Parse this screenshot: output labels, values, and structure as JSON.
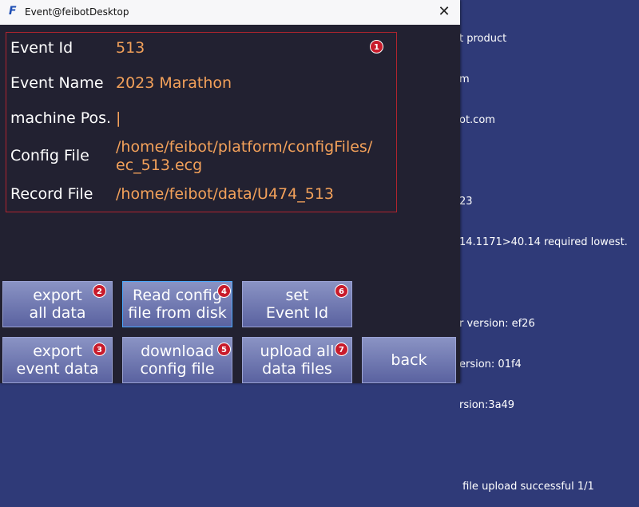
{
  "background": {
    "lines": [
      "t product",
      "m",
      "ot.com",
      "",
      "23",
      "14.1171>40.14 required lowest.",
      "",
      "r version: ef26",
      "ersion: 01f4",
      "rsion:3a49",
      "",
      " file upload successful 1/1"
    ]
  },
  "window": {
    "title": "Event@feibotDesktop",
    "close_glyph": "✕",
    "logo_glyph": "F"
  },
  "fields": {
    "event_id": {
      "label": "Event Id",
      "value": "513"
    },
    "event_name": {
      "label": "Event Name",
      "value": "2023 Marathon"
    },
    "machine_pos": {
      "label": "machine Pos.",
      "value": "|"
    },
    "config_file": {
      "label": "Config File",
      "value_line1": "/home/feibot/platform/configFiles/",
      "value_line2": "ec_513.ecg"
    },
    "record_file": {
      "label": "Record File",
      "value": "/home/feibot/data/U474_513"
    }
  },
  "badges": [
    "1",
    "2",
    "3",
    "4",
    "5",
    "6",
    "7"
  ],
  "buttons": {
    "export_all": {
      "line1": "export",
      "line2": "all data"
    },
    "export_event": {
      "line1": "export",
      "line2": "event data"
    },
    "read_config": {
      "line1": "Read config",
      "line2": "file from disk"
    },
    "download_config": {
      "line1": "download",
      "line2": "config file"
    },
    "set_event": {
      "line1": "set",
      "line2": "Event Id"
    },
    "upload_all": {
      "line1": "upload all",
      "line2": "data files"
    },
    "back": {
      "line1": "back"
    }
  },
  "colors": {
    "window_bg": "#222131",
    "value_text": "#f3a15a",
    "frame_border": "#b1242e",
    "badge_bg": "#c81b2b",
    "desktop_bg": "#2f3a78"
  }
}
